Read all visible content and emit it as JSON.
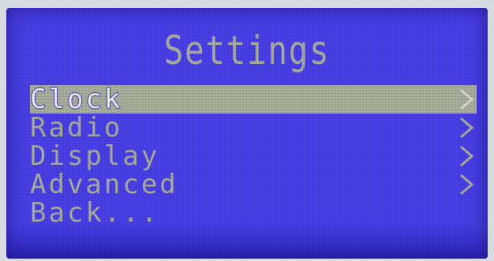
{
  "screen": {
    "title": "Settings",
    "menu": [
      {
        "label": "Clock",
        "selected": true,
        "has_submenu": true,
        "icon": "chevron-right-icon"
      },
      {
        "label": "Radio",
        "selected": false,
        "has_submenu": true,
        "icon": "chevron-right-icon"
      },
      {
        "label": "Display",
        "selected": false,
        "has_submenu": true,
        "icon": "chevron-right-icon"
      },
      {
        "label": "Advanced",
        "selected": false,
        "has_submenu": true,
        "icon": "chevron-right-icon"
      },
      {
        "label": "Back...",
        "selected": false,
        "has_submenu": false
      }
    ]
  },
  "colors": {
    "lcd_background": "#4a3fe6",
    "lcd_foreground": "#a9ae9b",
    "highlight_text": "#f1f2ee"
  }
}
